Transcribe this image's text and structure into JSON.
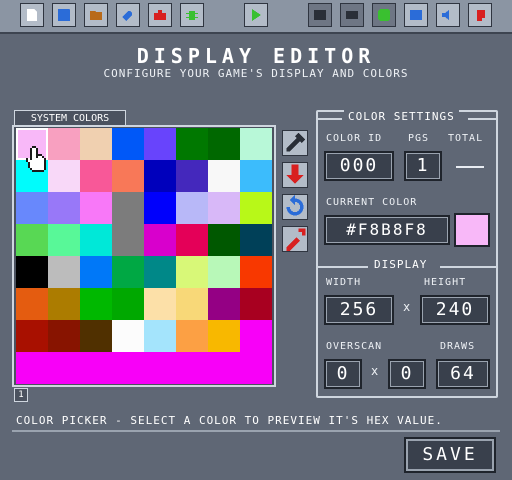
{
  "toolbar": {
    "buttons": [
      {
        "name": "new-file-icon",
        "color": "#ffffff"
      },
      {
        "name": "save-disk-icon",
        "color": "#2b6cd8"
      },
      {
        "name": "open-folder-icon",
        "color": "#b86a1a"
      },
      {
        "name": "wrench-icon",
        "color": "#2b6cd8"
      },
      {
        "name": "toolbox-icon",
        "color": "#d82020"
      },
      {
        "name": "bug-icon",
        "color": "#3ac030"
      },
      {
        "name": "play-icon",
        "color": "#3ac030"
      },
      {
        "name": "terminal-icon",
        "color": "#2a2f38"
      },
      {
        "name": "display-icon",
        "color": "#2a2f38"
      },
      {
        "name": "sprite-icon",
        "color": "#3ac030"
      },
      {
        "name": "image-icon",
        "color": "#2b6cd8"
      },
      {
        "name": "speaker-icon",
        "color": "#2b6cd8"
      },
      {
        "name": "music-icon",
        "color": "#d82020"
      }
    ]
  },
  "header": {
    "title": "DISPLAY EDITOR",
    "subtitle": "CONFIGURE YOUR GAME'S DISPLAY AND COLORS"
  },
  "palette": {
    "tab_label": "SYSTEM COLORS",
    "page": "1",
    "colors": [
      "#F8B8F8",
      "#F8A0C0",
      "#F0D0B0",
      "#0058F8",
      "#6844FC",
      "#007800",
      "#006800",
      "#B8F8D8",
      "#00FCFC",
      "#F8D8F8",
      "#F85898",
      "#F87858",
      "#0000BC",
      "#4428BC",
      "#F8F8F8",
      "#3CBCFC",
      "#6888FC",
      "#9878F8",
      "#F878F8",
      "#7C7C7C",
      "#0000FC",
      "#B8B8F8",
      "#D8B8F8",
      "#B8F818",
      "#58D854",
      "#58F898",
      "#00E8D8",
      "#7C7C7C",
      "#D800CC",
      "#E40058",
      "#005800",
      "#004058",
      "#000000",
      "#BCBCBC",
      "#0078F8",
      "#00A844",
      "#008888",
      "#D8F878",
      "#B8F8B8",
      "#F83800",
      "#E45C10",
      "#AC7C00",
      "#00B800",
      "#00A800",
      "#FCE0A8",
      "#F8D878",
      "#940084",
      "#A80020",
      "#A81000",
      "#881400",
      "#503000",
      "#FCFCFC",
      "#A4E4FC",
      "#FCA044",
      "#F8B800",
      "#F800F8",
      "#F800F8",
      "#F800F8",
      "#F800F8",
      "#F800F8",
      "#F800F8",
      "#F800F8",
      "#F800F8",
      "#F800F8"
    ]
  },
  "tools": [
    {
      "name": "eyedropper-icon",
      "color": "#2a2f38"
    },
    {
      "name": "import-icon",
      "color": "#d82020"
    },
    {
      "name": "revert-icon",
      "color": "#2b6cd8"
    },
    {
      "name": "clear-icon",
      "color": "#d82020"
    }
  ],
  "color_settings": {
    "title": "COLOR SETTINGS",
    "color_id_label": "COLOR ID",
    "pgs_label": "PGS",
    "total_label": "TOTAL",
    "color_id": "000",
    "pgs": "1",
    "current_color_label": "CURRENT COLOR",
    "current_color_hex": "#F8B8F8",
    "current_color": "#F8B8F8"
  },
  "display": {
    "title": "DISPLAY",
    "width_label": "WIDTH",
    "height_label": "HEIGHT",
    "width": "256",
    "height": "240",
    "x_sep": "x",
    "overscan_label": "OVERSCAN",
    "draws_label": "DRAWS",
    "overscan_x": "0",
    "overscan_y": "0",
    "draws": "64"
  },
  "status": "COLOR PICKER - SELECT A COLOR TO PREVIEW IT'S HEX VALUE.",
  "save_label": "SAVE"
}
